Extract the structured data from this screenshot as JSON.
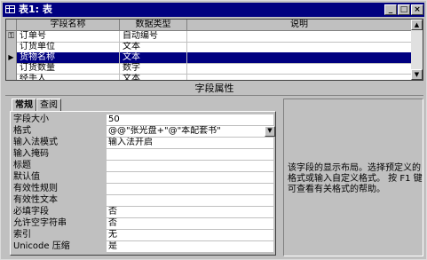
{
  "window": {
    "title": "表1: 表",
    "buttons": {
      "minimize": "_",
      "maximize": "□",
      "close": "×"
    }
  },
  "grid": {
    "headers": [
      "字段名称",
      "数据类型",
      "说明"
    ],
    "rows": [
      {
        "name": "订单号",
        "type": "自动编号",
        "desc": "",
        "selector": "key-icon"
      },
      {
        "name": "订货单位",
        "type": "文本",
        "desc": "",
        "selector": ""
      },
      {
        "name": "货物名称",
        "type": "文本",
        "desc": "",
        "selector": "row-pointer-icon",
        "active": true
      },
      {
        "name": "订货数量",
        "type": "数字",
        "desc": "",
        "selector": ""
      },
      {
        "name": "经手人",
        "type": "文本",
        "desc": "",
        "selector": ""
      }
    ]
  },
  "properties": {
    "section_title": "字段属性",
    "tabs": [
      "常规",
      "查阅"
    ],
    "rows": [
      {
        "label": "字段大小",
        "value": "50"
      },
      {
        "label": "格式",
        "value": "@@\"张光盘+\"@\"本配套书\"",
        "dropdown": true
      },
      {
        "label": "输入法模式",
        "value": "输入法开启"
      },
      {
        "label": "输入掩码",
        "value": ""
      },
      {
        "label": "标题",
        "value": ""
      },
      {
        "label": "默认值",
        "value": ""
      },
      {
        "label": "有效性规则",
        "value": ""
      },
      {
        "label": "有效性文本",
        "value": ""
      },
      {
        "label": "必填字段",
        "value": "否"
      },
      {
        "label": "允许空字符串",
        "value": "否"
      },
      {
        "label": "索引",
        "value": "无"
      },
      {
        "label": "Unicode 压缩",
        "value": "是"
      }
    ]
  },
  "help_text": "该字段的显示布局。选择预定义的格式或输入自定义格式。 按 F1 键可查看有关格式的帮助。"
}
